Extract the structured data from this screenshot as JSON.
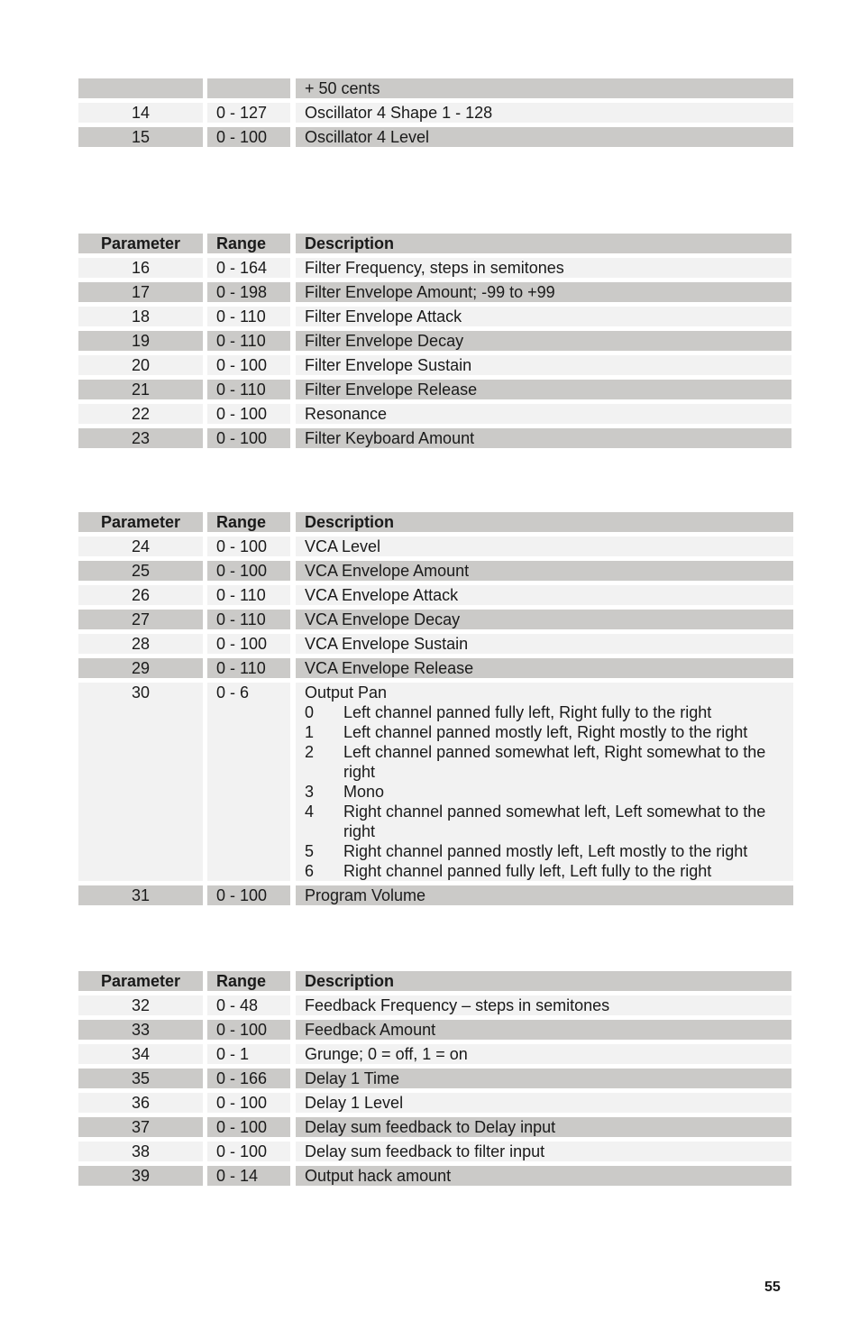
{
  "table_top": {
    "rows": [
      {
        "param": "",
        "range": "",
        "desc": "+ 50 cents",
        "shade": "dark"
      },
      {
        "param": "14",
        "range": "0 - 127",
        "desc": "Oscillator 4 Shape 1 - 128",
        "shade": "light"
      },
      {
        "param": "15",
        "range": "0 - 100",
        "desc": "Oscillator 4 Level",
        "shade": "dark"
      }
    ]
  },
  "headers": {
    "param": "Parameter",
    "range": "Range",
    "desc": "Description"
  },
  "table_filter": {
    "rows": [
      {
        "param": "16",
        "range": "0 - 164",
        "desc": "Filter Frequency, steps in semitones"
      },
      {
        "param": "17",
        "range": "0 - 198",
        "desc": "Filter Envelope Amount;  -99 to +99"
      },
      {
        "param": "18",
        "range": "0 - 110",
        "desc": "Filter Envelope Attack"
      },
      {
        "param": "19",
        "range": "0 - 110",
        "desc": "Filter Envelope Decay"
      },
      {
        "param": "20",
        "range": "0 - 100",
        "desc": "Filter Envelope Sustain"
      },
      {
        "param": "21",
        "range": "0 - 110",
        "desc": "Filter Envelope Release"
      },
      {
        "param": "22",
        "range": "0 - 100",
        "desc": "Resonance"
      },
      {
        "param": "23",
        "range": "0 - 100",
        "desc": "Filter Keyboard Amount"
      }
    ]
  },
  "table_vca": {
    "rows": [
      {
        "param": "24",
        "range": "0 - 100",
        "desc": "VCA Level"
      },
      {
        "param": "25",
        "range": "0 - 100",
        "desc": "VCA Envelope Amount"
      },
      {
        "param": "26",
        "range": "0 - 110",
        "desc": "VCA Envelope Attack"
      },
      {
        "param": "27",
        "range": "0 - 110",
        "desc": "VCA Envelope Decay"
      },
      {
        "param": "28",
        "range": "0 - 100",
        "desc": "VCA Envelope Sustain"
      },
      {
        "param": "29",
        "range": "0 - 110",
        "desc": "VCA Envelope Release"
      }
    ],
    "pan": {
      "param": "30",
      "range": "0 - 6",
      "title": "Output Pan",
      "options": [
        {
          "num": "0",
          "text": "Left channel panned fully left, Right fully to the right"
        },
        {
          "num": "1",
          "text": "Left channel panned mostly left, Right mostly to the right"
        },
        {
          "num": "2",
          "text": "Left channel panned somewhat left, Right somewhat to the right"
        },
        {
          "num": "3",
          "text": "Mono"
        },
        {
          "num": "4",
          "text": "Right channel panned somewhat left, Left somewhat to the right"
        },
        {
          "num": "5",
          "text": "Right channel panned mostly left, Left mostly to the right"
        },
        {
          "num": "6",
          "text": "Right channel panned fully left, Left fully to the right"
        }
      ]
    },
    "last": {
      "param": "31",
      "range": "0 - 100",
      "desc": "Program Volume"
    }
  },
  "table_fx": {
    "rows": [
      {
        "param": "32",
        "range": "0 - 48",
        "desc": "Feedback Frequency – steps in semitones"
      },
      {
        "param": "33",
        "range": "0 - 100",
        "desc": "Feedback Amount"
      },
      {
        "param": "34",
        "range": "0 - 1",
        "desc": "Grunge; 0 = off, 1 = on"
      },
      {
        "param": "35",
        "range": "0 - 166",
        "desc": "Delay 1 Time"
      },
      {
        "param": "36",
        "range": "0 - 100",
        "desc": "Delay 1 Level"
      },
      {
        "param": "37",
        "range": "0 - 100",
        "desc": "Delay sum feedback to Delay input"
      },
      {
        "param": "38",
        "range": "0 - 100",
        "desc": "Delay sum feedback to filter input"
      },
      {
        "param": "39",
        "range": "0 - 14",
        "desc": "Output hack amount"
      }
    ]
  },
  "page_number": "55"
}
